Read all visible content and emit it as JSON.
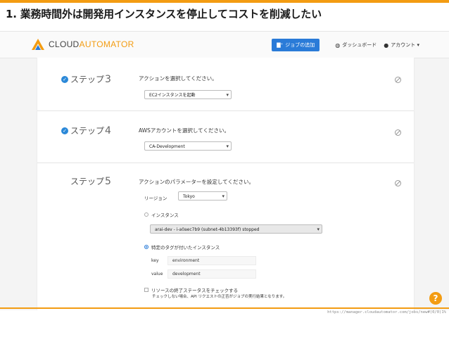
{
  "slide": {
    "title": "1. 業務時間外は開発用インスタンスを停止してコストを削減したい"
  },
  "header": {
    "logo_prefix": "CLOUD",
    "logo_suffix": "AUTOMATOR",
    "add_button_label": "ジョブの追加",
    "dashboard_label": "ダッシュボード",
    "account_label": "アカウント ▾"
  },
  "steps": [
    {
      "label": "ステップ",
      "number": "3",
      "completed": true,
      "question": "アクションを選択してください。",
      "select_value": "EC2インスタンスを起動"
    },
    {
      "label": "ステップ",
      "number": "4",
      "completed": true,
      "question": "AWSアカウントを選択してください。",
      "select_value": "CA-Development"
    },
    {
      "label": "ステップ",
      "number": "5",
      "completed": false,
      "question": "アクションのパラメーターを設定してください。",
      "region_label": "リージョン",
      "region_value": "Tokyo",
      "instance_radio_label": "インスタンス",
      "instance_select_value": "arai-dev - i-a0aec7b9 (subnet-4b13393f) stopped",
      "tag_radio_label": "特定のタグが付いたインスタンス",
      "key_label": "key",
      "key_value": "environment",
      "value_label": "value",
      "value_value": "development",
      "check_status_label": "リソースの終了ステータスをチェックする",
      "check_status_note": "チェックしない場合、API リクエストの正否がジョブの実行結果となります。"
    }
  ],
  "help_label": "?",
  "footer_url": "https://manager.cloudautomator.com/jobs/new#(0/0)1%",
  "colors": {
    "accent": "#f39c12",
    "primary": "#2a7bd8"
  }
}
